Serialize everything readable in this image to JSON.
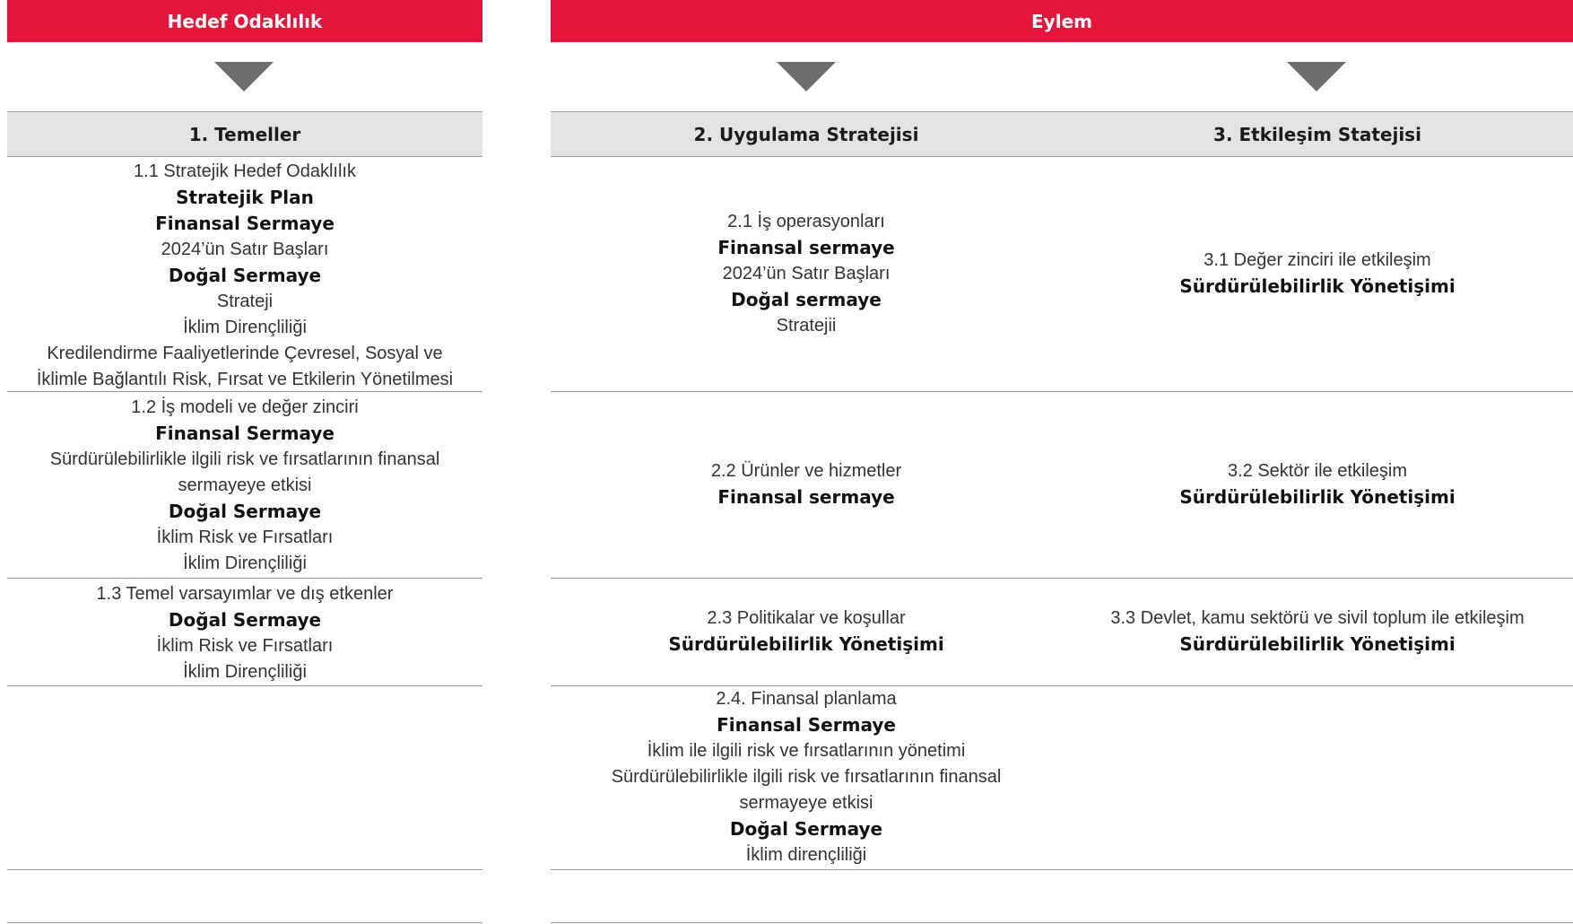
{
  "header": {
    "left_title": "Hedef Odaklılık",
    "right_title": "Eylem"
  },
  "columns": {
    "col1": "1. Temeller",
    "col2": "2. Uygulama Stratejisi",
    "col3": "3. Etkileşim Statejisi"
  },
  "c1": {
    "r1": {
      "l1": "1.1 Stratejik Hedef Odaklılık",
      "l2": "Stratejik Plan",
      "l3": "Finansal Sermaye",
      "l4": "2024’ün Satır Başları",
      "l5": "Doğal Sermaye",
      "l6": "Strateji",
      "l7": "İklim Dirençliliği",
      "l8": "Kredilendirme Faaliyetlerinde Çevresel, Sosyal ve",
      "l9": "İklimle Bağlantılı Risk, Fırsat ve Etkilerin Yönetilmesi"
    },
    "r2": {
      "l1": "1.2 İş modeli ve değer zinciri",
      "l2": "Finansal Sermaye",
      "l3": "Sürdürülebilirlikle ilgili risk ve fırsatlarının finansal",
      "l4": "sermayeye etkisi",
      "l5": "Doğal Sermaye",
      "l6": "İklim Risk ve Fırsatları",
      "l7": "İklim Dirençliliği"
    },
    "r3": {
      "l1": "1.3 Temel varsayımlar ve dış etkenler",
      "l2": "Doğal Sermaye",
      "l3": "İklim Risk ve Fırsatları",
      "l4": "İklim Dirençliliği"
    }
  },
  "c2": {
    "r1": {
      "l1": "2.1 İş operasyonları",
      "l2": "Finansal sermaye",
      "l3": "2024’ün Satır Başları",
      "l4": "Doğal sermaye",
      "l5": "Stratejii"
    },
    "r2": {
      "l1": "2.2 Ürünler ve hizmetler",
      "l2": "Finansal sermaye"
    },
    "r3": {
      "l1": "2.3 Politikalar ve koşullar",
      "l2": "Sürdürülebilirlik Yönetişimi"
    },
    "r4": {
      "l1": "2.4. Finansal planlama",
      "l2": "Finansal Sermaye",
      "l3": "İklim ile ilgili risk ve fırsatlarının yönetimi",
      "l4": "Sürdürülebilirlikle ilgili risk ve fırsatlarının finansal",
      "l5": "sermayeye etkisi",
      "l6": "Doğal Sermaye",
      "l7": "İklim dirençliliği"
    }
  },
  "c3": {
    "r1": {
      "l1": "3.1 Değer zinciri ile etkileşim",
      "l2": "Sürdürülebilirlik Yönetişimi"
    },
    "r2": {
      "l1": "3.2 Sektör ile etkileşim",
      "l2": "Sürdürülebilirlik Yönetişimi"
    },
    "r3": {
      "l1": "3.3 Devlet, kamu sektörü ve sivil toplum ile etkileşim",
      "l2": "Sürdürülebilirlik Yönetişimi"
    }
  },
  "colors": {
    "header_red": "#e3173e",
    "band_gray": "#e3e3e5",
    "arrow_gray": "#6d6d6d"
  },
  "icons": [
    "triangle-down-icon"
  ]
}
